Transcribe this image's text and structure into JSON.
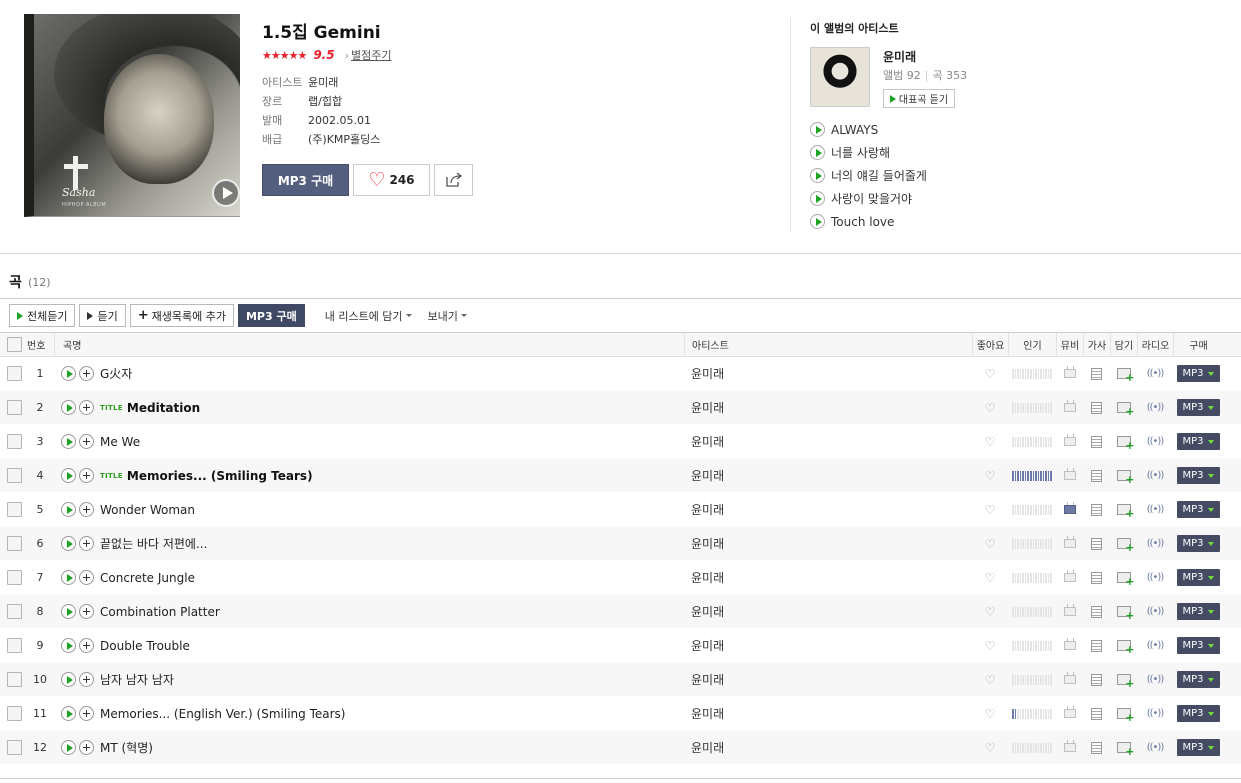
{
  "album": {
    "title": "1.5집 Gemini",
    "stars": "★★★★★",
    "score": "9.5",
    "rate_link": "별점주기",
    "info": [
      {
        "key": "아티스트",
        "value": "윤미래"
      },
      {
        "key": "장르",
        "value": "랩/힙합"
      },
      {
        "key": "발매",
        "value": "2002.05.01"
      },
      {
        "key": "배급",
        "value": "(주)KMP홀딩스"
      }
    ],
    "buy_label": "MP3 구매",
    "like_count": "246",
    "cover": {
      "signature": "Sasha",
      "small_text": "HIPHOP ALBUM"
    }
  },
  "artist_panel": {
    "heading": "이 앨범의 아티스트",
    "name": "윤미래",
    "albums_label": "앨범",
    "albums_count": "92",
    "songs_label": "곡",
    "songs_count": "353",
    "play_label": "대표곡 듣기",
    "top_songs": [
      "ALWAYS",
      "너를 사랑해",
      "너의 얘길 들어줄게",
      "사랑이 맞을거야",
      "Touch love"
    ]
  },
  "tracks_section": {
    "title": "곡",
    "count": "(12)"
  },
  "toolbar": {
    "play_all": "전체듣기",
    "play": "듣기",
    "add_playlist": "재생목록에 추가",
    "buy_mp3": "MP3 구매",
    "my_list": "내 리스트에 담기",
    "send": "보내기"
  },
  "table": {
    "headers": {
      "num": "번호",
      "title": "곡명",
      "artist": "아티스트",
      "like": "좋아요",
      "popularity": "인기",
      "mv": "뮤비",
      "lyrics": "가사",
      "save": "담기",
      "radio": "라디오",
      "buy": "구매"
    },
    "title_tag": "TITLE",
    "mp3_label": "MP3",
    "rows": [
      {
        "num": "1",
        "title": "G火자",
        "artist": "윤미래",
        "is_title": false,
        "popularity": 0,
        "mv": false
      },
      {
        "num": "2",
        "title": "Meditation",
        "artist": "윤미래",
        "is_title": true,
        "popularity": 0,
        "mv": false
      },
      {
        "num": "3",
        "title": "Me We",
        "artist": "윤미래",
        "is_title": false,
        "popularity": 0,
        "mv": false
      },
      {
        "num": "4",
        "title": "Memories... (Smiling Tears)",
        "artist": "윤미래",
        "is_title": true,
        "popularity": 1.0,
        "mv": false
      },
      {
        "num": "5",
        "title": "Wonder Woman",
        "artist": "윤미래",
        "is_title": false,
        "popularity": 0,
        "mv": true
      },
      {
        "num": "6",
        "title": "끝없는 바다 저편에...",
        "artist": "윤미래",
        "is_title": false,
        "popularity": 0,
        "mv": false
      },
      {
        "num": "7",
        "title": "Concrete Jungle",
        "artist": "윤미래",
        "is_title": false,
        "popularity": 0,
        "mv": false
      },
      {
        "num": "8",
        "title": "Combination Platter",
        "artist": "윤미래",
        "is_title": false,
        "popularity": 0,
        "mv": false
      },
      {
        "num": "9",
        "title": "Double Trouble",
        "artist": "윤미래",
        "is_title": false,
        "popularity": 0,
        "mv": false
      },
      {
        "num": "10",
        "title": "남자 남자 남자",
        "artist": "윤미래",
        "is_title": false,
        "popularity": 0,
        "mv": false
      },
      {
        "num": "11",
        "title": "Memories... (English Ver.) (Smiling Tears)",
        "artist": "윤미래",
        "is_title": false,
        "popularity": 0.1,
        "mv": false
      },
      {
        "num": "12",
        "title": "MT (혁명)",
        "artist": "윤미래",
        "is_title": false,
        "popularity": 0,
        "mv": false
      }
    ]
  },
  "colors": {
    "accent_red": "#e8222d",
    "play_green": "#1ea424",
    "button_navy": "#545f80",
    "popularity_blue": "#6c7ba6"
  }
}
